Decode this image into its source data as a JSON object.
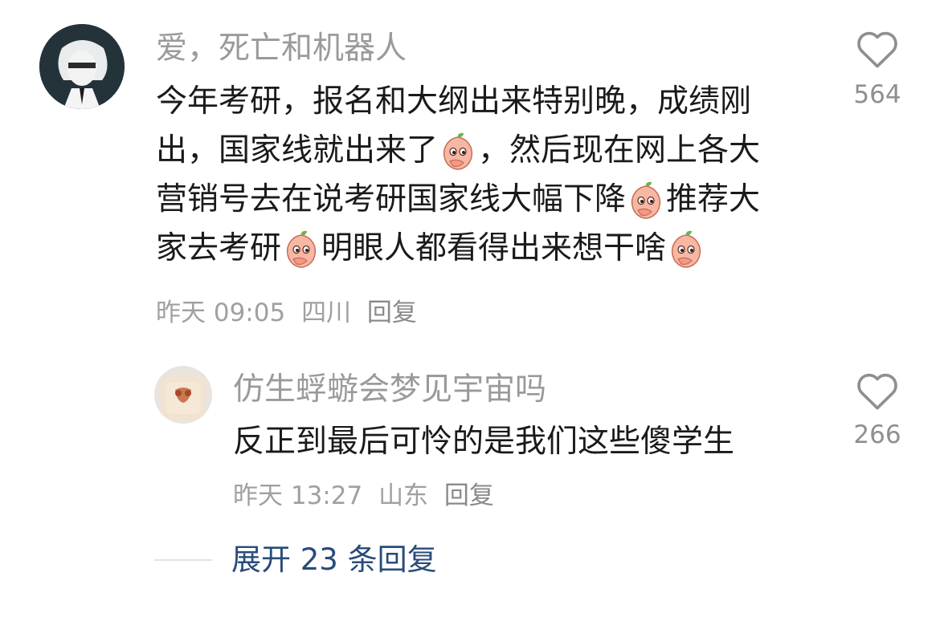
{
  "colors": {
    "username": "#9a9a9a",
    "text": "#1a1a1a",
    "meta": "#a0a0a0",
    "link": "#284b7a"
  },
  "comment": {
    "username": "爱，死亡和机器人",
    "lines": [
      [
        "今年考研，报名和大纲出来特别晚，成绩刚"
      ],
      [
        "出，国家线就出来了",
        "[emoji]",
        "，然后现在网上各大"
      ],
      [
        "营销号去在说考研国家线大幅下降",
        "[emoji]",
        "推荐大"
      ],
      [
        "家去考研",
        "[emoji]",
        "明眼人都看得出来想干啥",
        "[emoji]"
      ]
    ],
    "time": "昨天 09:05",
    "location": "四川",
    "reply_label": "回复",
    "likes": "564",
    "like_icon": "heart-outline-icon"
  },
  "reply": {
    "username": "仿生蜉蝣会梦见宇宙吗",
    "text": "反正到最后可怜的是我们这些傻学生",
    "time": "昨天 13:27",
    "location": "山东",
    "reply_label": "回复",
    "likes": "266",
    "like_icon": "heart-outline-icon"
  },
  "expand": {
    "label": "展开 23 条回复"
  },
  "emoji_name": "peach-covering-mouth-emoji"
}
